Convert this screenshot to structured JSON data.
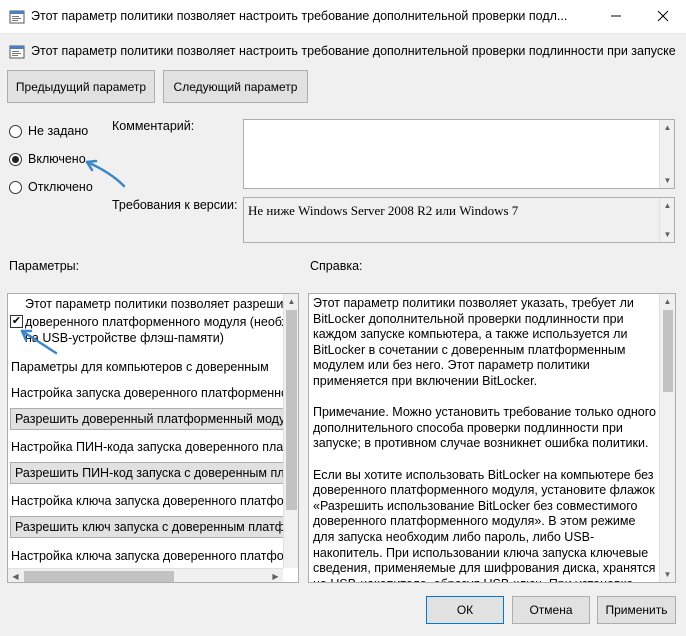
{
  "window": {
    "title": "Этот параметр политики позволяет настроить требование дополнительной проверки подл...",
    "minimize_icon": "minimize-icon",
    "close_icon": "close-icon"
  },
  "policy": {
    "header": "Этот параметр политики позволяет настроить требование дополнительной проверки подлинности при запуске"
  },
  "nav": {
    "prev_label": "Предыдущий параметр",
    "next_label": "Следующий параметр"
  },
  "state": {
    "options": [
      {
        "label": "Не задано",
        "selected": false
      },
      {
        "label": "Включено",
        "selected": true
      },
      {
        "label": "Отключено",
        "selected": false
      }
    ]
  },
  "comment": {
    "label": "Комментарий:",
    "value": ""
  },
  "version": {
    "label": "Требования к версии:",
    "value": "Не ниже Windows Server 2008 R2 или Windows 7"
  },
  "params": {
    "label": "Параметры:",
    "lines": [
      "Этот параметр политики позволяет разрешить",
      "доверенного платформенного модуля (необхо",
      "на USB-устройстве флэш-памяти)",
      "Параметры для компьютеров с доверенным",
      "Настройка запуска доверенного платформенного",
      "Разрешить доверенный платформенный модуль",
      "Настройка ПИН-кода запуска доверенного платф",
      "Разрешить ПИН-код запуска с доверенным плато",
      "Настройка ключа запуска доверенного платфор",
      "Разрешить ключ запуска с доверенным платфор",
      "Настройка ключа запуска доверенного платформ"
    ],
    "checkbox_checked": true
  },
  "help": {
    "label": "Справка:",
    "paragraphs": [
      "Этот параметр политики позволяет указать, требует ли BitLocker дополнительной проверки подлинности при каждом запуске компьютера, а также используется ли BitLocker в сочетании с доверенным платформенным модулем или без него. Этот параметр политики применяется при включении BitLocker.",
      "Примечание. Можно установить требование только одного дополнительного способа проверки подлинности при запуске; в противном случае возникнет ошибка политики.",
      "Если вы хотите использовать BitLocker на компьютере без доверенного платформенного модуля, установите флажок «Разрешить использование BitLocker без совместимого доверенного платформенного модуля». В этом режиме для запуска необходим либо пароль, либо USB-накопитель. При использовании ключа запуска ключевые сведения, применяемые для шифрования диска, хранятся на USB-накопителе, образуя USB-ключ. При установке USB-ключа"
    ]
  },
  "buttons": {
    "ok": "ОК",
    "cancel": "Отмена",
    "apply": "Применить"
  },
  "colors": {
    "accent": "#0078d7",
    "annotation_arrow": "#3a86c8"
  }
}
